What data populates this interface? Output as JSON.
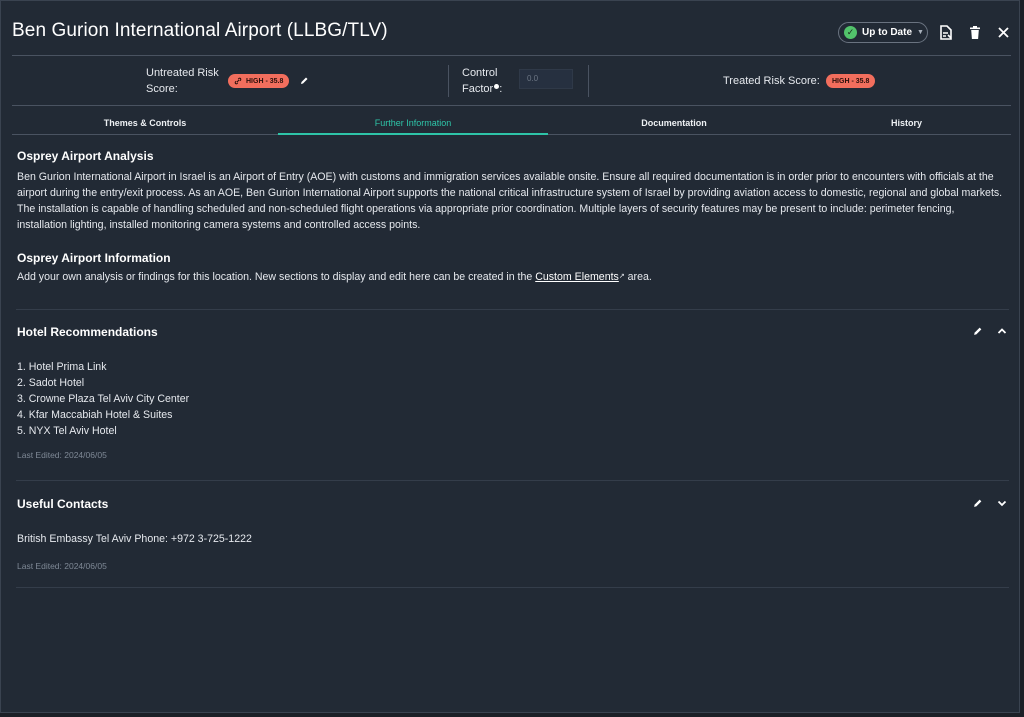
{
  "header": {
    "title": "Ben Gurion International Airport (LLBG/TLV)",
    "status_label": "Up to Date",
    "icons": [
      "export-icon",
      "trash-icon",
      "close-icon"
    ]
  },
  "scores": {
    "untreated_label_line1": "Untreated Risk",
    "untreated_label_line2": "Score:",
    "untreated_badge": "HIGH -  35.8",
    "control_label_line1": "Control",
    "control_label_line2": "Factor",
    "control_value": "0.0",
    "treated_label": "Treated Risk Score:",
    "treated_badge": "HIGH -  35.8"
  },
  "tabs": [
    {
      "label": "Themes & Controls",
      "active": false
    },
    {
      "label": "Further Information",
      "active": true
    },
    {
      "label": "Documentation",
      "active": false
    },
    {
      "label": "History",
      "active": false
    }
  ],
  "analysis": {
    "heading": "Osprey Airport Analysis",
    "text": "Ben Gurion International Airport in Israel is an Airport of Entry (AOE) with customs and immigration services available onsite. Ensure all required documentation is in order prior to encounters with officials at the airport during the entry/exit process. As an AOE, Ben Gurion International Airport supports the national critical infrastructure system of Israel by providing aviation access to domestic, regional and global markets. The installation is capable of handling scheduled and non-scheduled flight operations via appropriate prior coordination. Multiple layers of security features may be present to include: perimeter fencing, installation lighting, installed monitoring camera systems and controlled access points."
  },
  "information": {
    "heading": "Osprey Airport Information",
    "text_before": "Add your own analysis or findings for this location. New sections to display and edit here can be created in the ",
    "link": "Custom Elements",
    "text_after": " area."
  },
  "hotels": {
    "heading": "Hotel Recommendations",
    "items": [
      "1. Hotel Prima Link",
      "2. Sadot Hotel",
      "3. Crowne Plaza Tel Aviv City Center",
      "4. Kfar Maccabiah Hotel & Suites",
      "5. NYX Tel Aviv Hotel"
    ],
    "last_edited": "Last Edited: 2024/06/05"
  },
  "contacts": {
    "heading": "Useful Contacts",
    "text": "British Embassy Tel Aviv Phone: +972 3-725-1222",
    "last_edited": "Last Edited: 2024/06/05"
  },
  "colors": {
    "accent": "#2ec4a8",
    "risk_high": "#f26e5d",
    "status_ok": "#52c36b",
    "panel_bg": "#222a35"
  }
}
